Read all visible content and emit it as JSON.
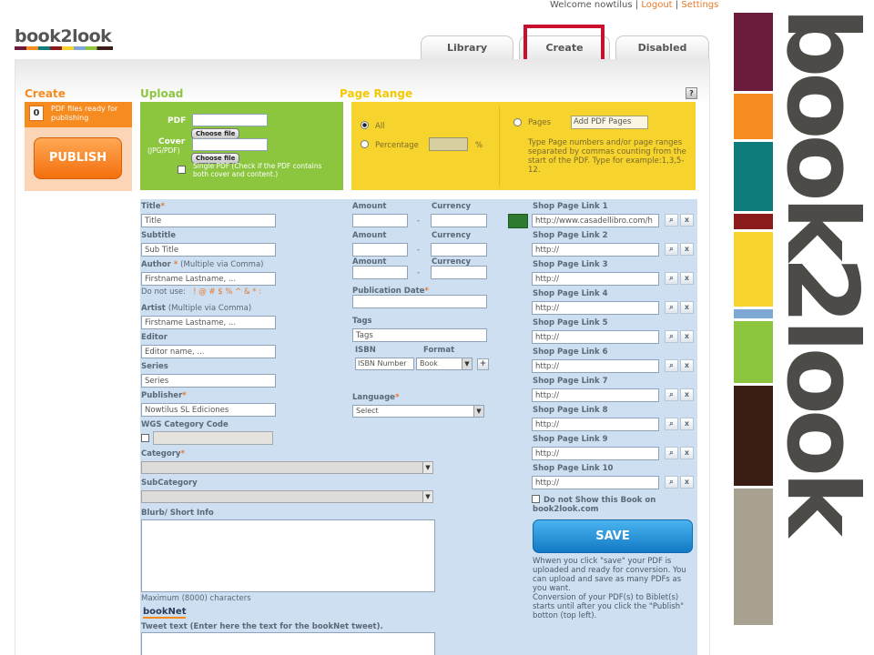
{
  "header": {
    "welcome": "Welcome nowtilus",
    "sep1": "|",
    "logout": "Logout",
    "sep2": "|",
    "settings": "Settings",
    "logo": "book2look"
  },
  "tabs": [
    {
      "label": "Library"
    },
    {
      "label": "Create"
    },
    {
      "label": "Disabled"
    }
  ],
  "create": {
    "title": "Create",
    "count": "0",
    "count_text": "PDF files ready for publishing",
    "publish": "PUBLISH"
  },
  "upload": {
    "title": "Upload",
    "pdf_label": "PDF",
    "cover_label": "Cover",
    "cover_sub": "(JPG/PDF)",
    "choose": "Choose file",
    "single_text": "Single PDF (Check if the PDF contains both cover and content.)"
  },
  "page_range": {
    "title": "Page Range",
    "help": "?",
    "all": "All",
    "percentage": "Percentage",
    "pct": "%",
    "pages": "Pages",
    "add_pages": "Add PDF Pages",
    "hint": "Type Page numbers and/or page ranges separated by commas counting from the start of the PDF. Type for example:1,3,5-12."
  },
  "form": {
    "title_label": "Title",
    "title_ph": "Title",
    "subtitle_label": "Subtitle",
    "subtitle_ph": "Sub Title",
    "author_label": "Author",
    "author_hint": "(Multiple via Comma)",
    "author_ph": "Firstname Lastname, ...",
    "do_not_use": "Do not use:",
    "forbidden": "! @ # $ % ^ & * :",
    "artist_label": "Artist",
    "artist_hint": "(Multiple via Comma)",
    "artist_ph": "Firstname Lastname, ...",
    "editor_label": "Editor",
    "editor_ph": "Editor name, ...",
    "series_label": "Series",
    "series_ph": "Series",
    "publisher_label": "Publisher",
    "publisher_val": "Nowtilus SL Ediciones",
    "wgs_label": "WGS Category Code",
    "category_label": "Category",
    "subcategory_label": "SubCategory",
    "blurb_label": "Blurb/ Short Info",
    "max_chars": "Maximum (8000) characters",
    "booknet_logo": "bookNet",
    "tweet_label": "Tweet text (Enter here the text for the bookNet tweet).",
    "amount_label": "Amount",
    "currency_label": "Currency",
    "dash": "-",
    "pubdate_label": "Publication Date",
    "tags_label": "Tags",
    "tags_ph": "Tags",
    "isbn_label": "ISBN",
    "isbn_ph": "ISBN Number",
    "format_label": "Format",
    "format_val": "Book",
    "plus": "+",
    "language_label": "Language",
    "language_val": "Select"
  },
  "shop": {
    "links": [
      {
        "label": "Shop Page Link 1",
        "value": "http://www.casadellibro.com/h"
      },
      {
        "label": "Shop Page Link 2",
        "value": "http://"
      },
      {
        "label": "Shop Page Link 3",
        "value": "http://"
      },
      {
        "label": "Shop Page Link 4",
        "value": "http://"
      },
      {
        "label": "Shop Page Link 5",
        "value": "http://"
      },
      {
        "label": "Shop Page Link 6",
        "value": "http://"
      },
      {
        "label": "Shop Page Link 7",
        "value": "http://"
      },
      {
        "label": "Shop Page Link 8",
        "value": "http://"
      },
      {
        "label": "Shop Page Link 9",
        "value": "http://"
      },
      {
        "label": "Shop Page Link 10",
        "value": "http://"
      }
    ],
    "search_glyph": "⌕",
    "remove_glyph": "x",
    "donot_show": "Do not Show this Book on book2look.com",
    "save": "SAVE",
    "save_note": "Whwen you click \"save\" your PDF is uploaded and ready for conversion. You can upload and save as many PDFs as you want.",
    "conversion_note": "Conversion of your PDF(s) to Biblet(s) starts until after you click the \"Publish\" botton (top left)."
  },
  "side_logo": "book2look",
  "colors": {
    "orange": "#f68b1f",
    "green": "#8cc63f",
    "yellow": "#f6d32d",
    "panel_blue": "#cddff0",
    "highlight_red": "#c8102e",
    "save_blue": "#1a8ad4"
  }
}
